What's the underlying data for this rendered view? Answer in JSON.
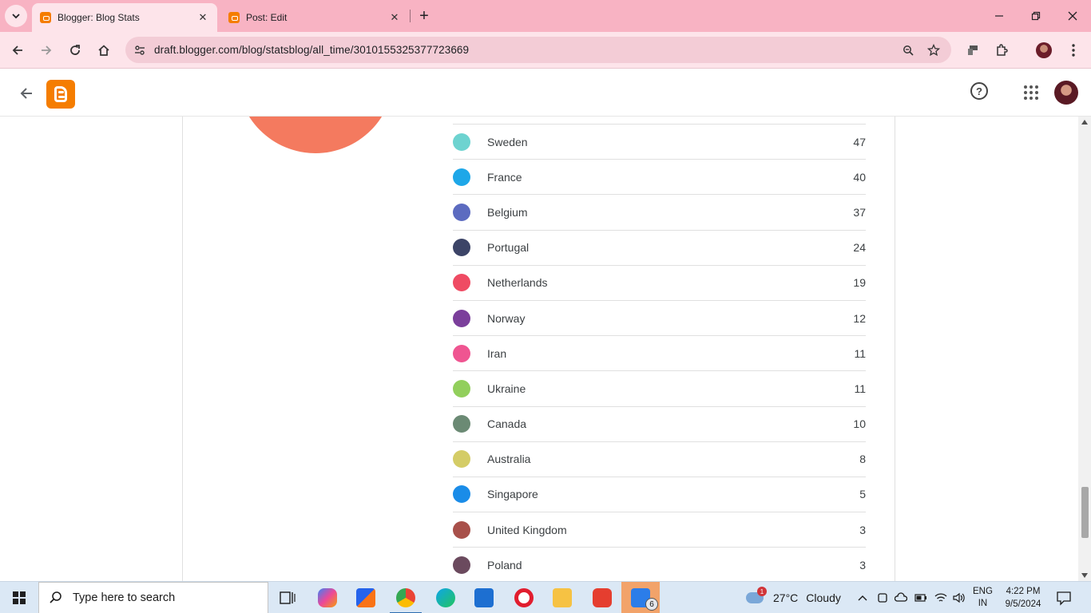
{
  "browser": {
    "tabs": [
      {
        "title": "Blogger: Blog Stats",
        "active": true
      },
      {
        "title": "Post: Edit",
        "active": false
      }
    ],
    "url": "draft.blogger.com/blog/statsblog/all_time/3010155325377723669"
  },
  "app": {
    "name": "Blogger"
  },
  "stats": {
    "rows": [
      {
        "country": "Sweden",
        "count": "47",
        "color": "#6dd3d0"
      },
      {
        "country": "France",
        "count": "40",
        "color": "#1ea7e8"
      },
      {
        "country": "Belgium",
        "count": "37",
        "color": "#5c6bc0"
      },
      {
        "country": "Portugal",
        "count": "24",
        "color": "#3c4467"
      },
      {
        "country": "Netherlands",
        "count": "19",
        "color": "#ef4b63"
      },
      {
        "country": "Norway",
        "count": "12",
        "color": "#7b3f9b"
      },
      {
        "country": "Iran",
        "count": "11",
        "color": "#ef5591"
      },
      {
        "country": "Ukraine",
        "count": "11",
        "color": "#92cf5c"
      },
      {
        "country": "Canada",
        "count": "10",
        "color": "#6b8a74"
      },
      {
        "country": "Australia",
        "count": "8",
        "color": "#d4cc66"
      },
      {
        "country": "Singapore",
        "count": "5",
        "color": "#1a8ce8"
      },
      {
        "country": "United Kingdom",
        "count": "3",
        "color": "#a8504a"
      },
      {
        "country": "Poland",
        "count": "3",
        "color": "#6b4a5e"
      }
    ],
    "pie_color": "#f47a5f"
  },
  "taskbar": {
    "search_placeholder": "Type here to search",
    "weather_temp": "27°C",
    "weather_text": "Cloudy",
    "weather_badge": "1",
    "lang_line1": "ENG",
    "lang_line2": "IN",
    "time": "4:22 PM",
    "date": "9/5/2024",
    "explorer_badge": "6"
  }
}
